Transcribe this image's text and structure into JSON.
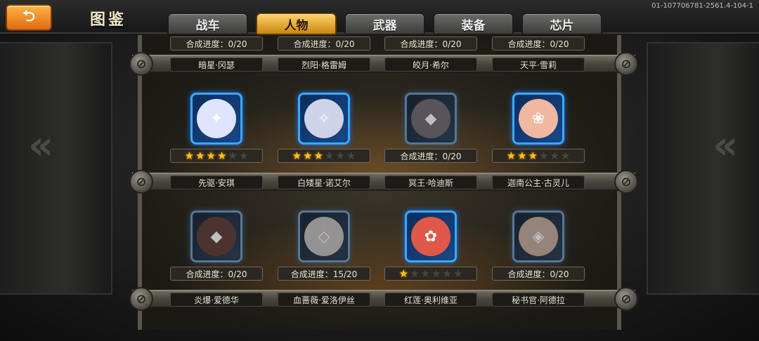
{
  "header": {
    "title": "图鉴",
    "build_id": "01-107706781-2561.4-104-1",
    "back_icon": "back-arrow-icon"
  },
  "tabs": [
    {
      "label": "战车",
      "active": false
    },
    {
      "label": "人物",
      "active": true
    },
    {
      "label": "武器",
      "active": false
    },
    {
      "label": "装备",
      "active": false
    },
    {
      "label": "芯片",
      "active": false
    }
  ],
  "top_row": {
    "progress": [
      "合成进度：0/20",
      "合成进度：0/20",
      "合成进度：0/20",
      "合成进度：0/20"
    ],
    "names": [
      "暗星·冈瑟",
      "烈阳·格雷姆",
      "皎月·希尔",
      "天平·雪莉"
    ]
  },
  "row1": [
    {
      "name": "先驱·安琪",
      "stars": 4,
      "max_stars": 6,
      "progress": null,
      "owned": true,
      "face_color": "#dfe4ff",
      "glyph": "✦"
    },
    {
      "name": "白矮星·诺艾尔",
      "stars": 3,
      "max_stars": 6,
      "progress": null,
      "owned": true,
      "face_color": "#cfd3ea",
      "glyph": "✧"
    },
    {
      "name": "冥王·哈迪斯",
      "stars": 0,
      "max_stars": 6,
      "progress": "合成进度：0/20",
      "owned": false,
      "face_color": "#7a6d80",
      "glyph": "◆"
    },
    {
      "name": "迦南公主·古灵儿",
      "stars": 3,
      "max_stars": 6,
      "progress": null,
      "owned": true,
      "face_color": "#f0b8a0",
      "glyph": "❀"
    }
  ],
  "row2": [
    {
      "name": "炎爆·爱德华",
      "stars": 0,
      "max_stars": 6,
      "progress": "合成进度：0/20",
      "owned": false,
      "face_color": "#8a3a2e",
      "glyph": "◆"
    },
    {
      "name": "血蔷薇·爱洛伊丝",
      "stars": 0,
      "max_stars": 6,
      "progress": "合成进度：15/20",
      "owned": false,
      "face_color": "#c9c2c2",
      "glyph": "◇"
    },
    {
      "name": "红莲·奥利维亚",
      "stars": 1,
      "max_stars": 6,
      "progress": null,
      "owned": true,
      "face_color": "#e0584a",
      "glyph": "✿"
    },
    {
      "name": "秘书官·阿德拉",
      "stars": 0,
      "max_stars": 6,
      "progress": "合成进度：0/20",
      "owned": false,
      "face_color": "#e8a888",
      "glyph": "◈"
    }
  ],
  "colors": {
    "accent": "#f0a020",
    "portrait_border": "#3aa9ff"
  }
}
